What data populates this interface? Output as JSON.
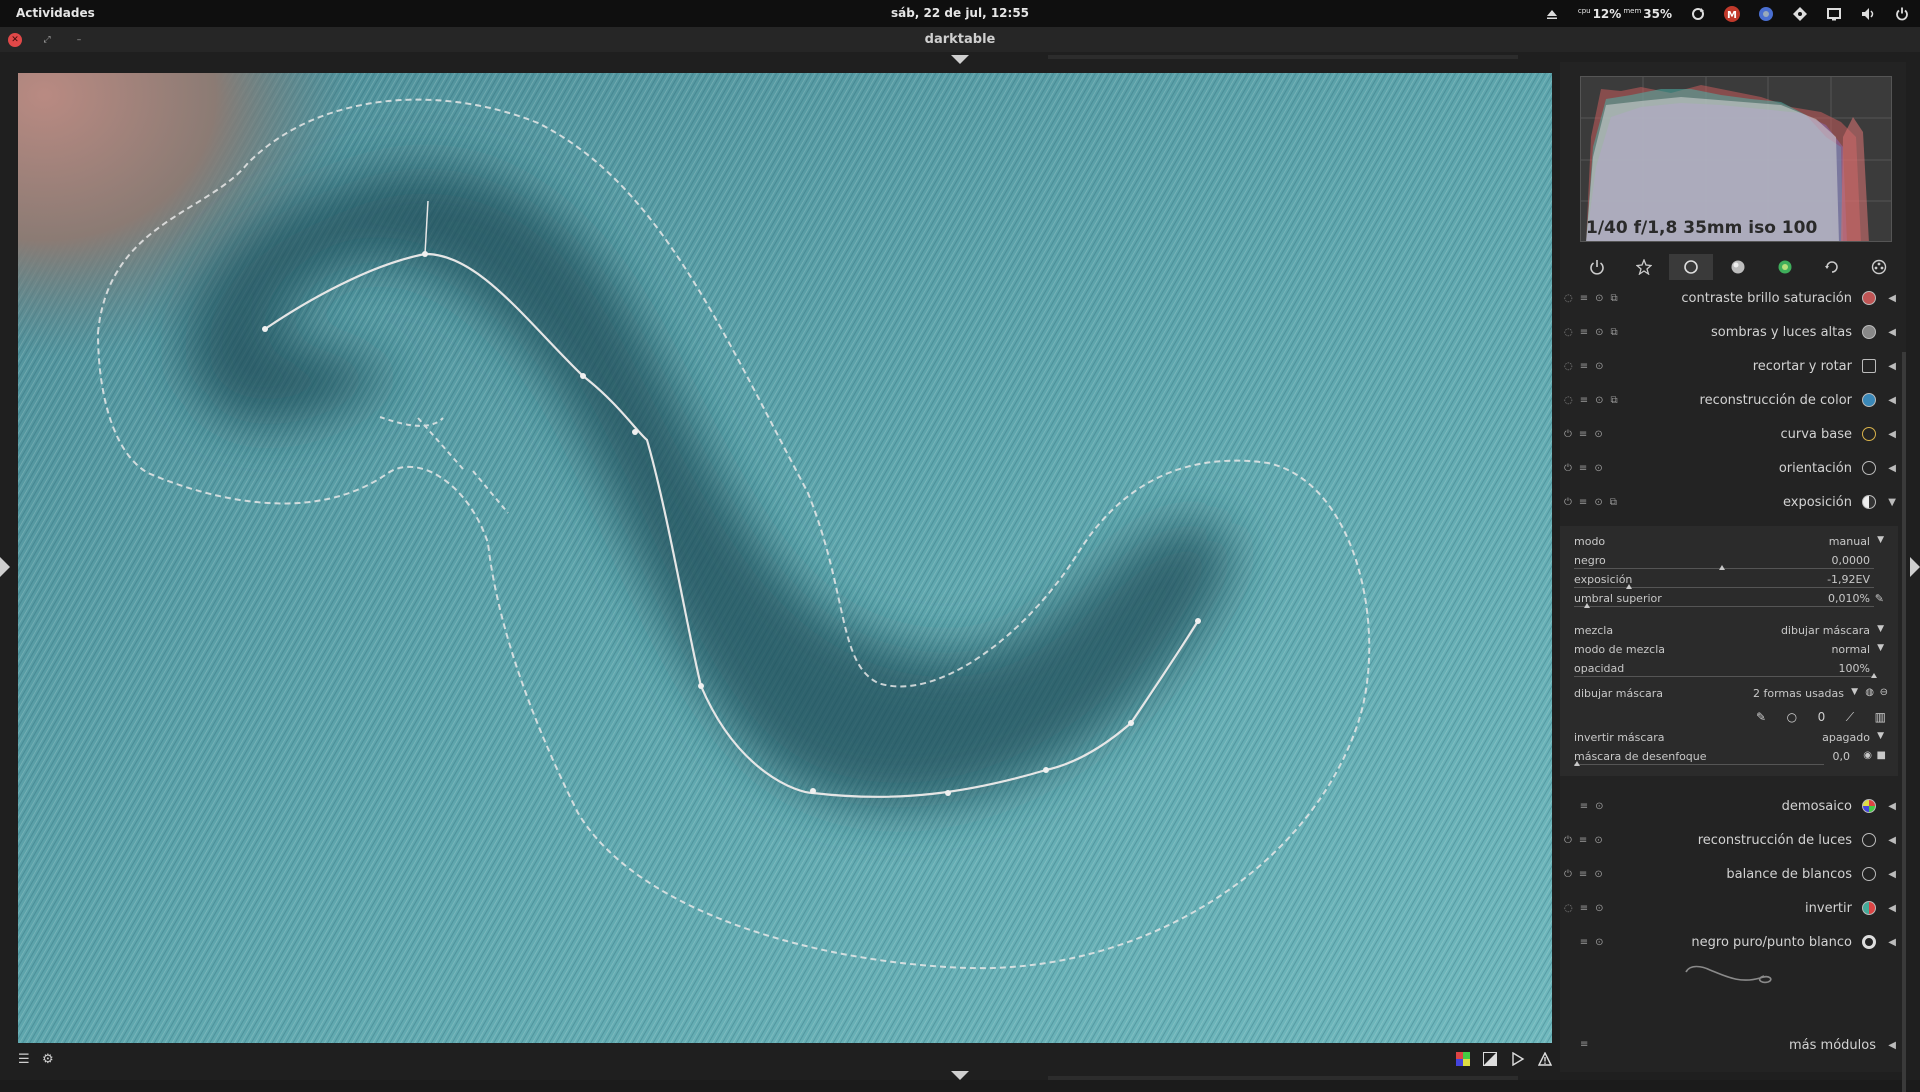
{
  "topbar": {
    "activities": "Actividades",
    "clock": "sáb, 22 de jul, 12:55",
    "cpu_label": "cpu",
    "cpu_value": "12%",
    "mem_label": "mem",
    "mem_value": "35%"
  },
  "window": {
    "title": "darktable"
  },
  "histogram": {
    "exif": "1/40 f/1,8 35mm iso 100"
  },
  "module_tabs": [
    "power-icon",
    "star-icon",
    "circle-icon",
    "sphere-icon",
    "color-icon",
    "rotate-icon",
    "film-icon"
  ],
  "modules_top": [
    {
      "name": "contraste brillo saturación",
      "icon": "contrast-icon"
    },
    {
      "name": "sombras y luces altas",
      "icon": "shadows-icon"
    },
    {
      "name": "recortar y rotar",
      "icon": "crop-icon"
    },
    {
      "name": "reconstrucción de color",
      "icon": "color-rec-icon"
    },
    {
      "name": "curva base",
      "icon": "curve-icon"
    },
    {
      "name": "orientación",
      "icon": "orientation-icon"
    },
    {
      "name": "exposición",
      "icon": "exposure-icon"
    }
  ],
  "exposure": {
    "modo_label": "modo",
    "modo_value": "manual",
    "negro_label": "negro",
    "negro_value": "0,0000",
    "exposicion_label": "exposición",
    "exposicion_value": "-1,92EV",
    "umbral_label": "umbral superior",
    "umbral_value": "0,010%",
    "mezcla_label": "mezcla",
    "mezcla_value": "dibujar máscara",
    "modo_mezcla_label": "modo de mezcla",
    "modo_mezcla_value": "normal",
    "opacidad_label": "opacidad",
    "opacidad_value": "100%",
    "dibujar_label": "dibujar máscara",
    "dibujar_value": "2 formas usadas",
    "invertir_label": "invertir máscara",
    "invertir_value": "apagado",
    "desenfoque_label": "máscara de desenfoque",
    "desenfoque_value": "0,0"
  },
  "modules_bottom": [
    {
      "name": "demosaico",
      "icon": "demosaic-icon"
    },
    {
      "name": "reconstrucción de luces",
      "icon": "highlight-icon"
    },
    {
      "name": "balance de blancos",
      "icon": "wb-icon"
    },
    {
      "name": "invertir",
      "icon": "invert-icon"
    },
    {
      "name": "negro puro/punto blanco",
      "icon": "levels-icon"
    }
  ],
  "more_modules": "más módulos"
}
